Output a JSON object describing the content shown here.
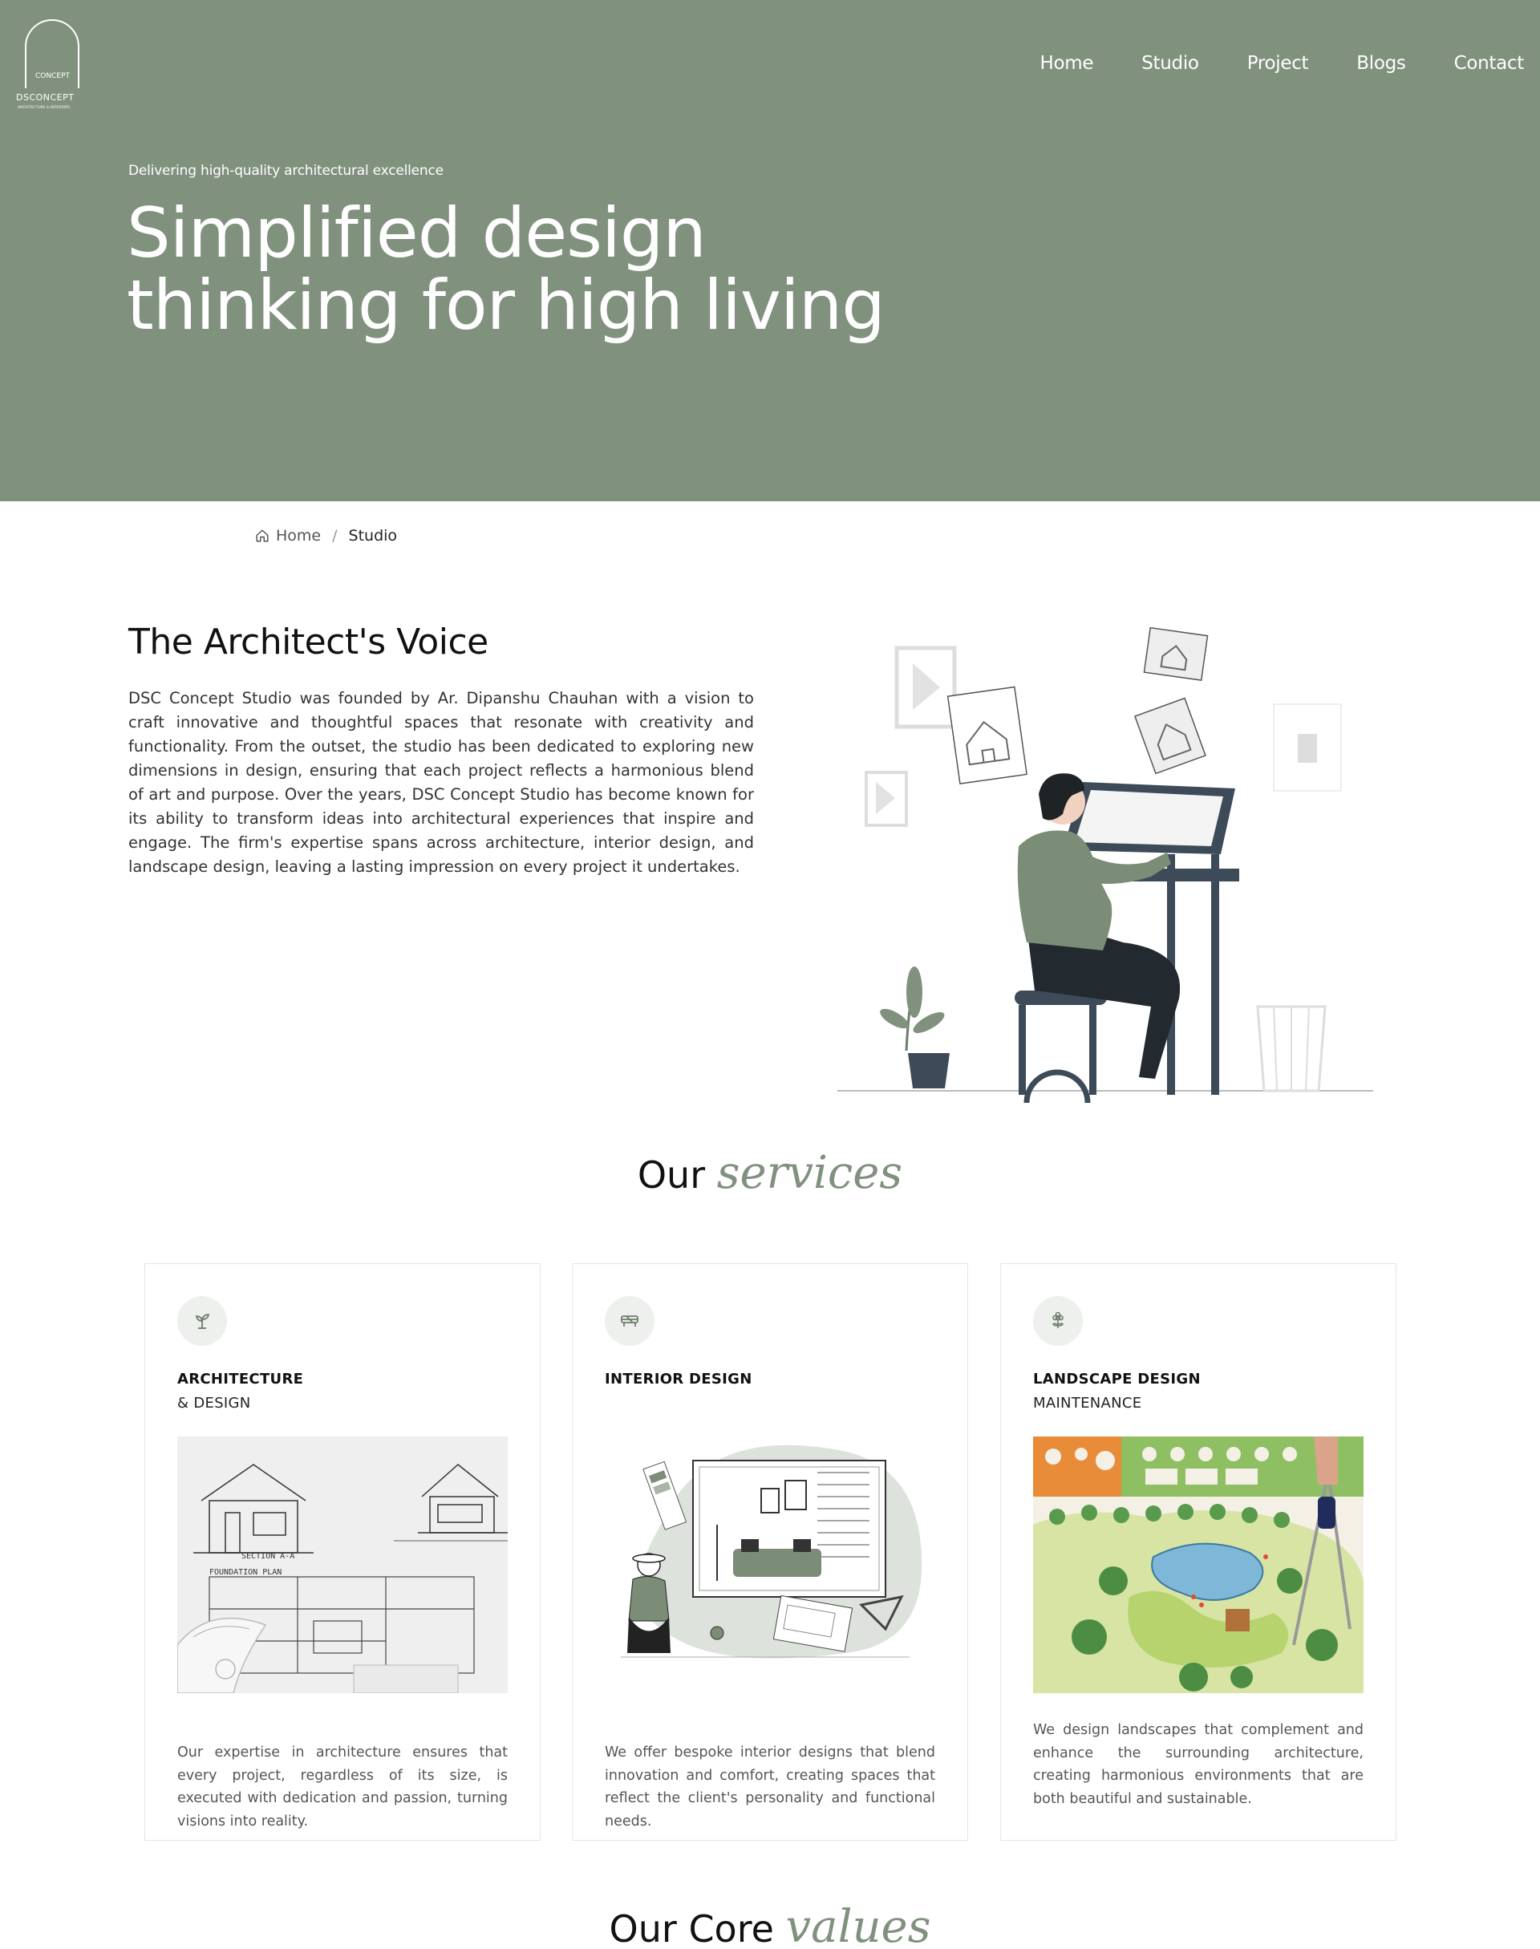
{
  "brand": {
    "logo_line1": "CONCEPT",
    "logo_line2": "DSCONCEPT",
    "logo_line3": "ARCHITECTURE & INTERIORS"
  },
  "nav": {
    "items": [
      {
        "label": "Home"
      },
      {
        "label": "Studio"
      },
      {
        "label": "Project"
      },
      {
        "label": "Blogs"
      },
      {
        "label": "Contact"
      }
    ]
  },
  "hero": {
    "kicker": "Delivering high-quality architectural excellence",
    "title_line1": "Simplified design",
    "title_line2": "thinking for high living"
  },
  "breadcrumb": {
    "home_label": "Home",
    "separator": "/",
    "current": "Studio"
  },
  "about": {
    "title": "The Architect's Voice",
    "body": "DSC Concept Studio was founded by Ar. Dipanshu Chauhan with a vision to craft innovative and thoughtful spaces that resonate with creativity and functionality. From the outset, the studio has been dedicated to exploring new dimensions in design, ensuring that each project reflects a harmonious blend of art and purpose. Over the years, DSC Concept Studio has become known for its ability to transform ideas into architectural experiences that inspire and engage. The firm's expertise spans across architecture, interior design, and landscape design, leaving a lasting impression on every project it undertakes."
  },
  "services": {
    "heading_plain": "Our",
    "heading_accent": "services",
    "cards": [
      {
        "icon": "sprout-icon",
        "title1": "ARCHITECTURE",
        "title2": "& DESIGN",
        "image_alt": "architectural-blueprints",
        "image_text1": "SECTION A-A",
        "image_text2": "FOUNDATION PLAN",
        "description": "Our expertise in architecture ensures that every project, regardless of its size, is executed with dedication and passion, turning visions into reality."
      },
      {
        "icon": "sofa-icon",
        "title1": "INTERIOR DESIGN",
        "title2": "",
        "image_alt": "interior-design-illustration",
        "description": "We offer bespoke interior designs that blend innovation and comfort, creating spaces that reflect the client's personality and functional needs."
      },
      {
        "icon": "flower-icon",
        "title1": "LANDSCAPE DESIGN",
        "title2": "MAINTENANCE",
        "image_alt": "landscape-plan-drawing",
        "description": "We design landscapes that complement and enhance the surrounding architecture, creating harmonious environments that are both beautiful and sustainable."
      }
    ]
  },
  "values": {
    "heading_plain": "Our Core",
    "heading_accent": "values"
  },
  "colors": {
    "hero_bg": "#80917e",
    "accent": "#80917e",
    "text_dark": "#111111",
    "text_muted": "#555555"
  }
}
